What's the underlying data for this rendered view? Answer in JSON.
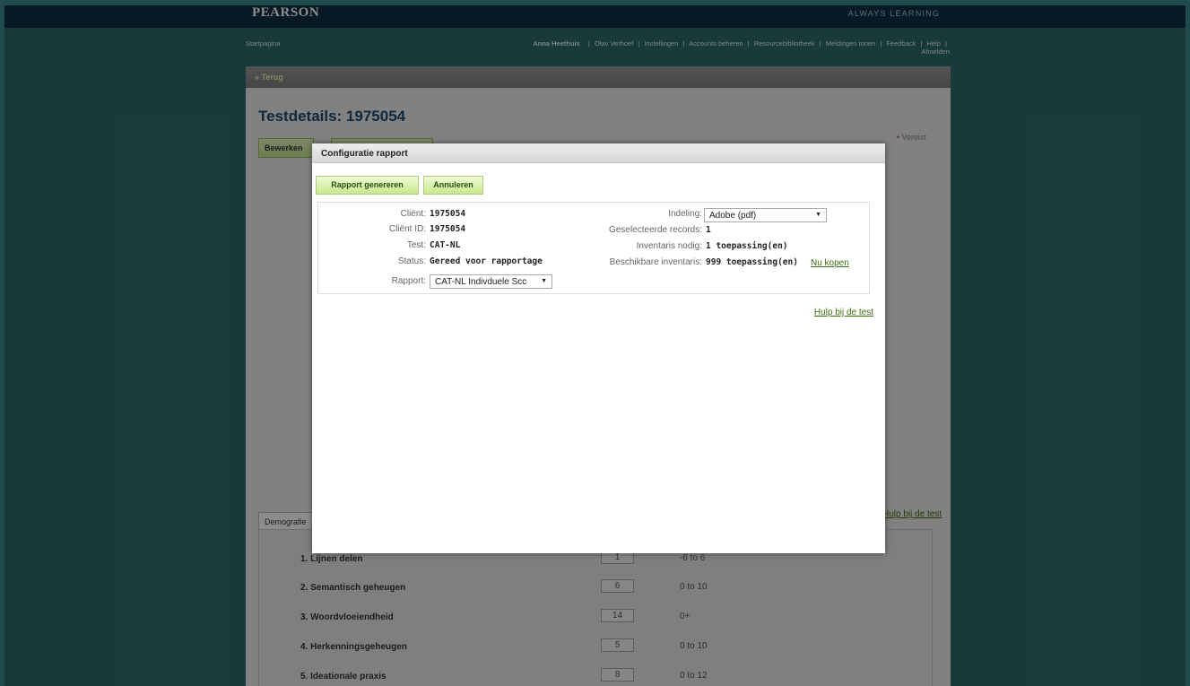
{
  "header": {
    "logo": "PEARSON",
    "tagline": "ALWAYS LEARNING"
  },
  "nav": {
    "home": "Startpagina",
    "user": "Anna Heethuis",
    "links": [
      "Olav Verhoef",
      "Instellingen",
      "Accounts beheren",
      "Resourcebibliotheek",
      "Meldingen tonen",
      "Feedback",
      "Help"
    ],
    "separator": "|",
    "logout": "Afmelden"
  },
  "page": {
    "back": "« Terug",
    "title": "Testdetails: 1975054",
    "required_marker": "•",
    "required_label": "Vereist",
    "edit_button": "Bewerken",
    "help_link": "Hulp bij de test",
    "demographics_tab": "Demografie"
  },
  "scores": [
    {
      "label": "1. Lijnen delen",
      "value": "1",
      "range": "-6 to 6"
    },
    {
      "label": "2. Semantisch geheugen",
      "value": "6",
      "range": "0 to 10"
    },
    {
      "label": "3. Woordvloeiendheid",
      "value": "14",
      "range": "0+"
    },
    {
      "label": "4. Herkenningsgeheugen",
      "value": "5",
      "range": "0 to 10"
    },
    {
      "label": "5. Ideationale praxis",
      "value": "8",
      "range": "0 to 12"
    }
  ],
  "modal": {
    "title": "Configuratie rapport",
    "generate_button": "Rapport genereren",
    "cancel_button": "Annuleren",
    "client_label": "Cliënt:",
    "client_value": "1975054",
    "client_id_label": "Cliënt ID:",
    "client_id_value": "1975054",
    "test_label": "Test:",
    "test_value": "CAT-NL",
    "status_label": "Status:",
    "status_value": "Gereed voor rapportage",
    "report_label": "Rapport:",
    "report_selected": "CAT-NL Indivduele Scc",
    "format_label": "Indeling:",
    "format_selected": "Adobe (pdf)",
    "selected_records_label": "Geselecteerde records:",
    "selected_records_value": "1",
    "inventory_needed_label": "Inventaris nodig:",
    "inventory_needed_value": "1 toepassing(en)",
    "inventory_available_label": "Beschikbare inventaris:",
    "inventory_available_value": "999 toepassing(en)",
    "buy_link": "Nu kopen",
    "help_link": "Hulp bij de test"
  },
  "colors": {
    "outer_background": "#1f4b4b",
    "page_background": "#2d6b6a",
    "header_background": "#0f2e45",
    "link_green": "#3e6d0f",
    "button_green": "#c9e890"
  },
  "icons": {
    "dropdown": "caret-down-icon"
  }
}
